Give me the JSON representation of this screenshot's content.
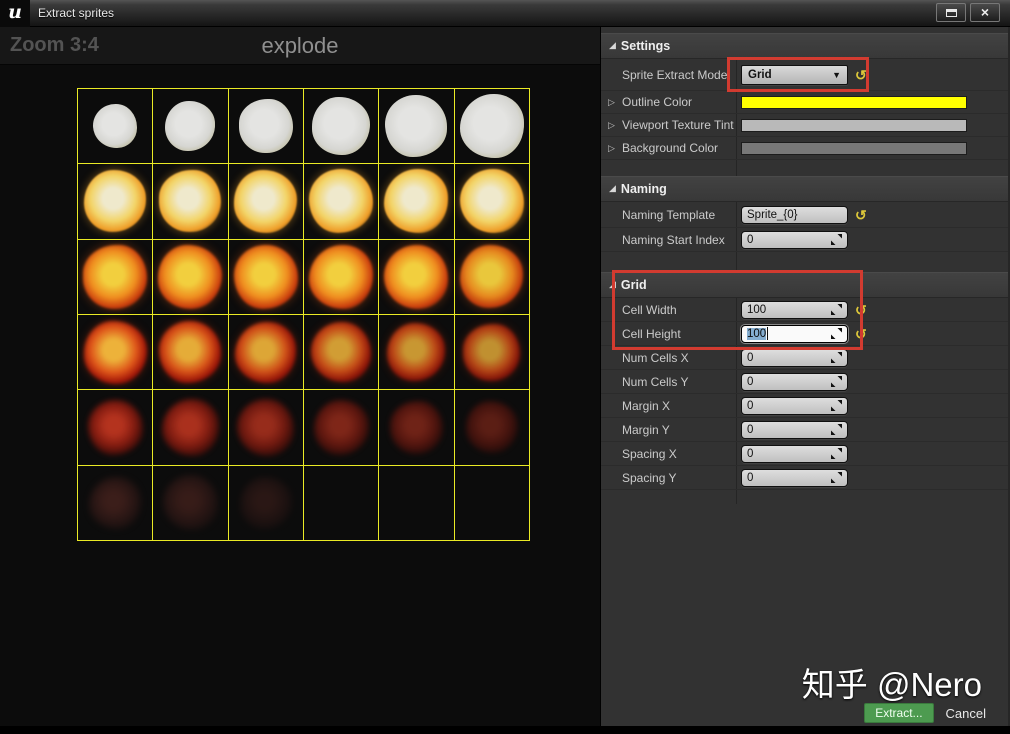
{
  "window": {
    "title": "Extract sprites",
    "logo_glyph": "u",
    "close_glyph": "×"
  },
  "viewport": {
    "zoom_label": "Zoom 3:4",
    "texture_name": "explode",
    "grid": {
      "cols": 6,
      "rows": 6,
      "line_color": "#eaea25",
      "sprite_rows": [
        {
          "colors": [
            "#e4e4e2",
            "#d6d6d2",
            "#c6c4ae"
          ],
          "hard": true,
          "blur": 0,
          "glow": "none",
          "sizes": [
            44,
            50,
            54,
            58,
            62,
            64
          ],
          "opacity": [
            1,
            1,
            1,
            1,
            1,
            1
          ]
        },
        {
          "colors": [
            "#efe9cc",
            "#f2d468",
            "#ee9c27"
          ],
          "hard": false,
          "blur": 0.7,
          "glow": "0 0 9px rgba(238,160,40,0.45)",
          "sizes": [
            62,
            62,
            63,
            64,
            64,
            64
          ],
          "opacity": [
            1,
            1,
            1,
            1,
            1,
            1
          ]
        },
        {
          "colors": [
            "#f2cf3e",
            "#ef8d1f",
            "#c93c0d"
          ],
          "hard": false,
          "blur": 1.2,
          "glow": "0 0 10px rgba(230,90,20,0.4)",
          "sizes": [
            64,
            64,
            64,
            64,
            64,
            63
          ],
          "opacity": [
            1,
            1,
            1,
            1,
            1,
            0.96
          ]
        },
        {
          "colors": [
            "#edb23a",
            "#de5519",
            "#a01508"
          ],
          "hard": false,
          "blur": 1.8,
          "glow": "0 0 9px rgba(190,50,10,0.35)",
          "sizes": [
            63,
            62,
            61,
            60,
            58,
            57
          ],
          "opacity": [
            1,
            0.97,
            0.93,
            0.88,
            0.84,
            0.8
          ]
        },
        {
          "colors": [
            "#d23a22",
            "#9c2012",
            "#55100a"
          ],
          "hard": false,
          "blur": 2.6,
          "glow": "none",
          "sizes": [
            55,
            57,
            57,
            55,
            53,
            52
          ],
          "opacity": [
            0.85,
            0.8,
            0.7,
            0.58,
            0.5,
            0.4
          ]
        },
        {
          "colors": [
            "#6b3028",
            "#4a221e",
            "#2e1715"
          ],
          "hard": false,
          "blur": 3.2,
          "glow": "none",
          "sizes": [
            52,
            55,
            52
          ],
          "opacity": [
            0.5,
            0.45,
            0.32
          ]
        }
      ]
    }
  },
  "panel": {
    "settings": {
      "title": "Settings",
      "mode": {
        "label": "Sprite Extract Mode",
        "value": "Grid"
      },
      "outline": {
        "label": "Outline Color",
        "color": "#ffff00"
      },
      "tint": {
        "label": "Viewport Texture Tint",
        "color": "#b9b9b9"
      },
      "bg": {
        "label": "Background Color",
        "color": "#787878"
      }
    },
    "naming": {
      "title": "Naming",
      "template": {
        "label": "Naming Template",
        "value": "Sprite_{0}"
      },
      "start_index": {
        "label": "Naming Start Index",
        "value": "0"
      }
    },
    "grid": {
      "title": "Grid",
      "cell_width": {
        "label": "Cell Width",
        "value": "100"
      },
      "cell_height": {
        "label": "Cell Height",
        "value": "100"
      },
      "num_cells_x": {
        "label": "Num Cells X",
        "value": "0"
      },
      "num_cells_y": {
        "label": "Num Cells Y",
        "value": "0"
      },
      "margin_x": {
        "label": "Margin X",
        "value": "0"
      },
      "margin_y": {
        "label": "Margin Y",
        "value": "0"
      },
      "spacing_x": {
        "label": "Spacing X",
        "value": "0"
      },
      "spacing_y": {
        "label": "Spacing Y",
        "value": "0"
      }
    },
    "annotation_color": "#d23b30"
  },
  "footer": {
    "watermark": "知乎 @Nero",
    "extract_label": "Extract...",
    "cancel_label": "Cancel"
  }
}
